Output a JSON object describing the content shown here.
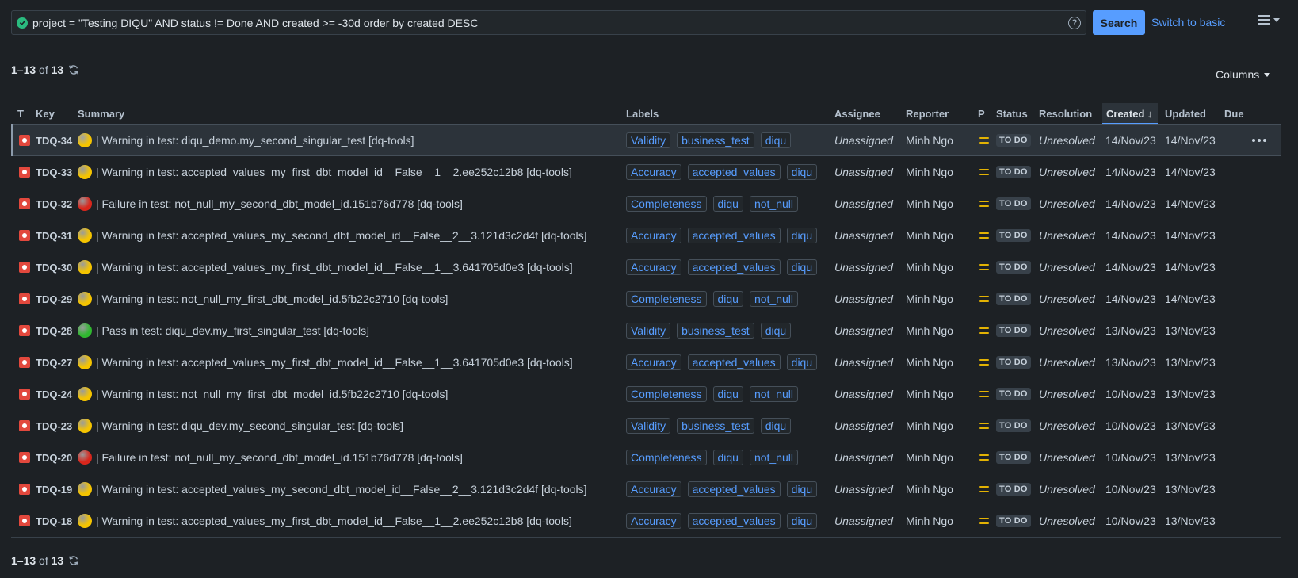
{
  "search": {
    "query": "project = \"Testing DIQU\" AND status != Done AND created >= -30d order by created DESC",
    "help": "?",
    "search_label": "Search",
    "switch_label": "Switch to basic"
  },
  "pagination": {
    "range": "1–13",
    "of": "of",
    "total": "13"
  },
  "columns_label": "Columns",
  "headers": {
    "type": "T",
    "key": "Key",
    "summary": "Summary",
    "labels": "Labels",
    "assignee": "Assignee",
    "reporter": "Reporter",
    "priority": "P",
    "status": "Status",
    "resolution": "Resolution",
    "created": "Created",
    "updated": "Updated",
    "due": "Due"
  },
  "colors": {
    "warning": "#f5c400",
    "failure": "#d9261c",
    "pass": "#2fb82f"
  },
  "rows": [
    {
      "key": "TDQ-34",
      "dot": "warning",
      "summary": "| Warning in test: diqu_demo.my_second_singular_test [dq-tools]",
      "labels": [
        "Validity",
        "business_test",
        "diqu"
      ],
      "assignee": "Unassigned",
      "reporter": "Minh Ngo",
      "status": "TO DO",
      "resolution": "Unresolved",
      "created": "14/Nov/23",
      "updated": "14/Nov/23"
    },
    {
      "key": "TDQ-33",
      "dot": "warning",
      "summary": "| Warning in test: accepted_values_my_first_dbt_model_id__False__1__2.ee252c12b8 [dq-tools]",
      "labels": [
        "Accuracy",
        "accepted_values",
        "diqu"
      ],
      "assignee": "Unassigned",
      "reporter": "Minh Ngo",
      "status": "TO DO",
      "resolution": "Unresolved",
      "created": "14/Nov/23",
      "updated": "14/Nov/23"
    },
    {
      "key": "TDQ-32",
      "dot": "failure",
      "summary": "| Failure in test: not_null_my_second_dbt_model_id.151b76d778 [dq-tools]",
      "labels": [
        "Completeness",
        "diqu",
        "not_null"
      ],
      "assignee": "Unassigned",
      "reporter": "Minh Ngo",
      "status": "TO DO",
      "resolution": "Unresolved",
      "created": "14/Nov/23",
      "updated": "14/Nov/23"
    },
    {
      "key": "TDQ-31",
      "dot": "warning",
      "summary": "| Warning in test: accepted_values_my_second_dbt_model_id__False__2__3.121d3c2d4f [dq-tools]",
      "labels": [
        "Accuracy",
        "accepted_values",
        "diqu"
      ],
      "assignee": "Unassigned",
      "reporter": "Minh Ngo",
      "status": "TO DO",
      "resolution": "Unresolved",
      "created": "14/Nov/23",
      "updated": "14/Nov/23"
    },
    {
      "key": "TDQ-30",
      "dot": "warning",
      "summary": "| Warning in test: accepted_values_my_first_dbt_model_id__False__1__3.641705d0e3 [dq-tools]",
      "labels": [
        "Accuracy",
        "accepted_values",
        "diqu"
      ],
      "assignee": "Unassigned",
      "reporter": "Minh Ngo",
      "status": "TO DO",
      "resolution": "Unresolved",
      "created": "14/Nov/23",
      "updated": "14/Nov/23"
    },
    {
      "key": "TDQ-29",
      "dot": "warning",
      "summary": "| Warning in test: not_null_my_first_dbt_model_id.5fb22c2710 [dq-tools]",
      "labels": [
        "Completeness",
        "diqu",
        "not_null"
      ],
      "assignee": "Unassigned",
      "reporter": "Minh Ngo",
      "status": "TO DO",
      "resolution": "Unresolved",
      "created": "14/Nov/23",
      "updated": "14/Nov/23"
    },
    {
      "key": "TDQ-28",
      "dot": "pass",
      "summary": "| Pass in test: diqu_dev.my_first_singular_test [dq-tools]",
      "labels": [
        "Validity",
        "business_test",
        "diqu"
      ],
      "assignee": "Unassigned",
      "reporter": "Minh Ngo",
      "status": "TO DO",
      "resolution": "Unresolved",
      "created": "13/Nov/23",
      "updated": "13/Nov/23"
    },
    {
      "key": "TDQ-27",
      "dot": "warning",
      "summary": "| Warning in test: accepted_values_my_first_dbt_model_id__False__1__3.641705d0e3 [dq-tools]",
      "labels": [
        "Accuracy",
        "accepted_values",
        "diqu"
      ],
      "assignee": "Unassigned",
      "reporter": "Minh Ngo",
      "status": "TO DO",
      "resolution": "Unresolved",
      "created": "13/Nov/23",
      "updated": "13/Nov/23"
    },
    {
      "key": "TDQ-24",
      "dot": "warning",
      "summary": "| Warning in test: not_null_my_first_dbt_model_id.5fb22c2710 [dq-tools]",
      "labels": [
        "Completeness",
        "diqu",
        "not_null"
      ],
      "assignee": "Unassigned",
      "reporter": "Minh Ngo",
      "status": "TO DO",
      "resolution": "Unresolved",
      "created": "10/Nov/23",
      "updated": "13/Nov/23"
    },
    {
      "key": "TDQ-23",
      "dot": "warning",
      "summary": "| Warning in test: diqu_dev.my_second_singular_test [dq-tools]",
      "labels": [
        "Validity",
        "business_test",
        "diqu"
      ],
      "assignee": "Unassigned",
      "reporter": "Minh Ngo",
      "status": "TO DO",
      "resolution": "Unresolved",
      "created": "10/Nov/23",
      "updated": "13/Nov/23"
    },
    {
      "key": "TDQ-20",
      "dot": "failure",
      "summary": "| Failure in test: not_null_my_second_dbt_model_id.151b76d778 [dq-tools]",
      "labels": [
        "Completeness",
        "diqu",
        "not_null"
      ],
      "assignee": "Unassigned",
      "reporter": "Minh Ngo",
      "status": "TO DO",
      "resolution": "Unresolved",
      "created": "10/Nov/23",
      "updated": "13/Nov/23"
    },
    {
      "key": "TDQ-19",
      "dot": "warning",
      "summary": "| Warning in test: accepted_values_my_second_dbt_model_id__False__2__3.121d3c2d4f [dq-tools]",
      "labels": [
        "Accuracy",
        "accepted_values",
        "diqu"
      ],
      "assignee": "Unassigned",
      "reporter": "Minh Ngo",
      "status": "TO DO",
      "resolution": "Unresolved",
      "created": "10/Nov/23",
      "updated": "13/Nov/23"
    },
    {
      "key": "TDQ-18",
      "dot": "warning",
      "summary": "| Warning in test: accepted_values_my_first_dbt_model_id__False__1__2.ee252c12b8 [dq-tools]",
      "labels": [
        "Accuracy",
        "accepted_values",
        "diqu"
      ],
      "assignee": "Unassigned",
      "reporter": "Minh Ngo",
      "status": "TO DO",
      "resolution": "Unresolved",
      "created": "10/Nov/23",
      "updated": "13/Nov/23"
    }
  ]
}
